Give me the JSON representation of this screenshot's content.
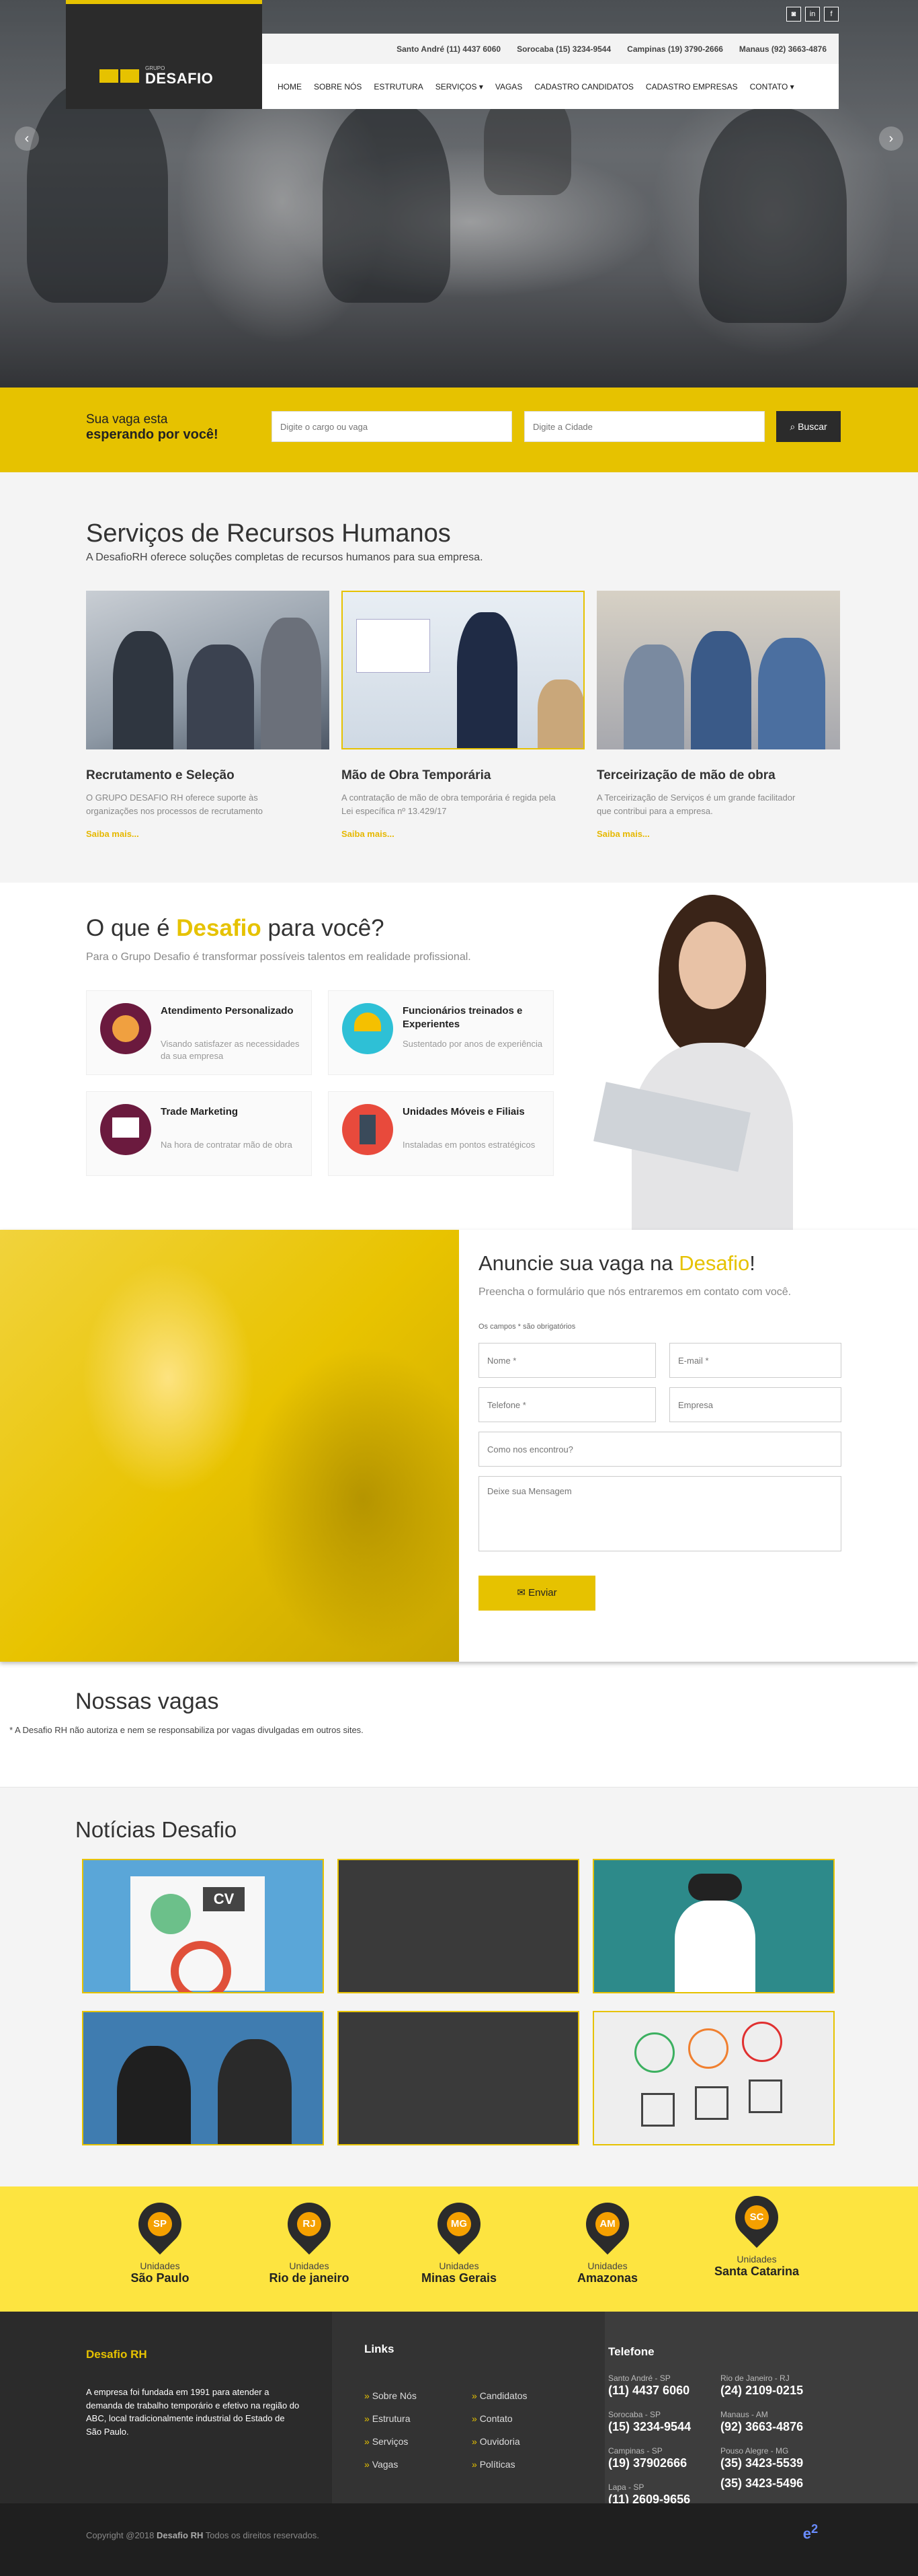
{
  "logo": {
    "small": "GRUPO",
    "name": "DESAFIO"
  },
  "topbar": {
    "phones": [
      "Santo André (11) 4437 6060",
      "Sorocaba (15) 3234-9544",
      "Campinas (19) 3790-2666",
      "Manaus (92) 3663-4876"
    ],
    "social": [
      "rss",
      "in",
      "f"
    ]
  },
  "nav": [
    "HOME",
    "SOBRE NÓS",
    "ESTRUTURA",
    "SERVIÇOS ▾",
    "VAGAS",
    "CADASTRO CANDIDATOS",
    "CADASTRO EMPRESAS",
    "CONTATO ▾"
  ],
  "search": {
    "line1": "Sua vaga esta",
    "line2": "esperando por você!",
    "cargo_placeholder": "Digite o cargo ou vaga",
    "cidade_placeholder": "Digite a Cidade",
    "button": "Buscar"
  },
  "services": {
    "title": "Serviços de Recursos Humanos",
    "subtitle": "A DesafioRH oferece soluções completas de recursos humanos para sua empresa.",
    "cards": [
      {
        "title": "Recrutamento e Seleção",
        "text": "O GRUPO DESAFIO RH oferece suporte às organizações nos processos de recrutamento",
        "link": "Saiba mais..."
      },
      {
        "title": "Mão de Obra Temporária",
        "text": "A contratação de mão de obra temporária é regida pela Lei específica nº 13.429/17",
        "link": "Saiba mais..."
      },
      {
        "title": "Terceirização de mão de obra",
        "text": "A Terceirização de Serviços é um grande facilitador que contribui para a empresa.",
        "link": "Saiba mais..."
      }
    ]
  },
  "desafio": {
    "title_pre": "O que é",
    "title_brand": "Desafio",
    "title_post": "para você?",
    "subtitle": "Para o Grupo Desafio é transformar possíveis talentos em realidade profissional.",
    "features": [
      {
        "title": "Atendimento Personalizado",
        "text": "Visando satisfazer as necessidades da sua empresa"
      },
      {
        "title": "Funcionários treinados e Experientes",
        "text": "Sustentado por anos de experiência"
      },
      {
        "title": "Trade Marketing",
        "text": "Na hora de contratar mão de obra"
      },
      {
        "title": "Unidades Móveis e Filiais",
        "text": "Instaladas em pontos estratégicos"
      }
    ]
  },
  "anuncie": {
    "title_pre": "Anuncie sua vaga na",
    "title_brand": "Desafio",
    "title_post": "!",
    "subtitle": "Preencha o formulário que nós entraremos em contato com você.",
    "required_note": "Os campos * são obrigatórios",
    "nome": "Nome *",
    "email": "E-mail *",
    "telefone": "Telefone *",
    "empresa": "Empresa",
    "como": "Como nos encontrou?",
    "mensagem": "Deixe sua Mensagem",
    "button": "Enviar"
  },
  "vagas": {
    "title": "Nossas vagas",
    "note": "* A Desafio RH não autoriza e nem se responsabiliza por vagas divulgadas em outros sites."
  },
  "noticias": {
    "title": "Notícias Desafio"
  },
  "unidades": [
    {
      "abbr": "SP",
      "label": "Unidades",
      "city": "São Paulo"
    },
    {
      "abbr": "RJ",
      "label": "Unidades",
      "city": "Rio de janeiro"
    },
    {
      "abbr": "MG",
      "label": "Unidades",
      "city": "Minas Gerais"
    },
    {
      "abbr": "AM",
      "label": "Unidades",
      "city": "Amazonas"
    },
    {
      "abbr": "SC",
      "label": "Unidades",
      "city": "Santa Catarina"
    }
  ],
  "footer": {
    "brand": "Desafio RH",
    "about": "A empresa foi fundada em 1991 para atender a demanda de trabalho temporário e efetivo na região do ABC, local tradicionalmente industrial do Estado de São Paulo.",
    "links_title": "Links",
    "links_col1": [
      "Sobre Nós",
      "Estrutura",
      "Serviços",
      "Vagas"
    ],
    "links_col2": [
      "Candidatos",
      "Contato",
      "Ouvidoria",
      "Políticas"
    ],
    "tel_title": "Telefone",
    "phones": [
      {
        "city": "Santo André - SP",
        "num": "(11) 4437 6060"
      },
      {
        "city": "Rio de Janeiro - RJ",
        "num": "(24) 2109-0215"
      },
      {
        "city": "Sorocaba - SP",
        "num": "(15) 3234-9544"
      },
      {
        "city": "Manaus - AM",
        "num": "(92) 3663-4876"
      },
      {
        "city": "Campinas - SP",
        "num": "(19) 37902666"
      },
      {
        "city": "Pouso Alegre - MG",
        "num": "(35) 3423-5539"
      },
      {
        "city": "",
        "num": "(35) 3423-5496"
      },
      {
        "city": "Lapa - SP",
        "num": "(11) 2609-9656"
      }
    ],
    "copyright_pre": "Copyright @2018",
    "copyright_brand": "Desafio RH",
    "copyright_post": "Todos os direitos reservados."
  },
  "colors": {
    "brand_yellow": "#e6c200",
    "unit_yellow": "#fde440",
    "dark": "#2b2b2b"
  }
}
